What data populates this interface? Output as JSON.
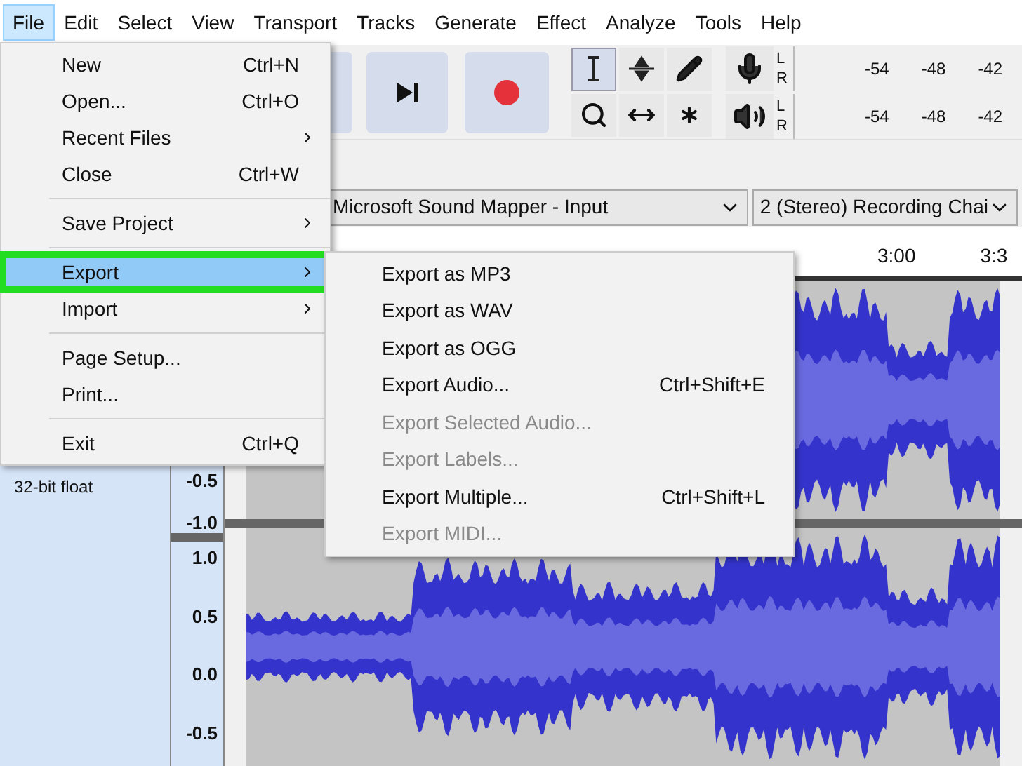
{
  "menubar": [
    {
      "label": "File",
      "selected": true
    },
    {
      "label": "Edit",
      "selected": false
    },
    {
      "label": "Select",
      "selected": false
    },
    {
      "label": "View",
      "selected": false
    },
    {
      "label": "Transport",
      "selected": false
    },
    {
      "label": "Tracks",
      "selected": false
    },
    {
      "label": "Generate",
      "selected": false
    },
    {
      "label": "Effect",
      "selected": false
    },
    {
      "label": "Analyze",
      "selected": false
    },
    {
      "label": "Tools",
      "selected": false
    },
    {
      "label": "Help",
      "selected": false
    }
  ],
  "meters": [
    {
      "kind": "record",
      "channels": [
        "L",
        "R"
      ],
      "ticks": [
        "-54",
        "-48",
        "-42"
      ]
    },
    {
      "kind": "playback",
      "channels": [
        "L",
        "R"
      ],
      "ticks": [
        "-54",
        "-48",
        "-42"
      ]
    }
  ],
  "devices": [
    {
      "value": "Microsoft Sound Mapper - Input"
    },
    {
      "value": "2 (Stereo) Recording Chai"
    }
  ],
  "ruler": {
    "labels": [
      "3:00",
      "3:3"
    ]
  },
  "track": {
    "info": [
      "32-bit float"
    ],
    "channels": [
      {
        "scale": [
          "-0.5",
          "-1.0"
        ]
      },
      {
        "scale": [
          "1.0",
          "0.5",
          "0.0",
          "-0.5"
        ]
      }
    ]
  },
  "file_menu": [
    {
      "kind": "item",
      "label": "New",
      "shortcut": "Ctrl+N",
      "submenu": false,
      "selected": false,
      "outlined": false
    },
    {
      "kind": "item",
      "label": "Open...",
      "shortcut": "Ctrl+O",
      "submenu": false,
      "selected": false,
      "outlined": false
    },
    {
      "kind": "item",
      "label": "Recent Files",
      "submenu": true,
      "selected": false,
      "outlined": false
    },
    {
      "kind": "item",
      "label": "Close",
      "shortcut": "Ctrl+W",
      "submenu": false,
      "selected": false,
      "outlined": false
    },
    {
      "kind": "separator"
    },
    {
      "kind": "item",
      "label": "Save Project",
      "submenu": true,
      "selected": false,
      "outlined": false
    },
    {
      "kind": "separator"
    },
    {
      "kind": "item",
      "label": "Export",
      "submenu": true,
      "selected": true,
      "outlined": true
    },
    {
      "kind": "item",
      "label": "Import",
      "submenu": true,
      "selected": false,
      "outlined": false
    },
    {
      "kind": "separator"
    },
    {
      "kind": "item",
      "label": "Page Setup...",
      "submenu": false,
      "selected": false,
      "outlined": false
    },
    {
      "kind": "item",
      "label": "Print...",
      "submenu": false,
      "selected": false,
      "outlined": false
    },
    {
      "kind": "separator"
    },
    {
      "kind": "item",
      "label": "Exit",
      "shortcut": "Ctrl+Q",
      "submenu": false,
      "selected": false,
      "outlined": false
    }
  ],
  "export_submenu": [
    {
      "label": "Export as MP3",
      "disabled": false
    },
    {
      "label": "Export as WAV",
      "disabled": false
    },
    {
      "label": "Export as OGG",
      "disabled": false
    },
    {
      "label": "Export Audio...",
      "shortcut": "Ctrl+Shift+E",
      "disabled": false
    },
    {
      "label": "Export Selected Audio...",
      "disabled": true
    },
    {
      "label": "Export Labels...",
      "disabled": true
    },
    {
      "label": "Export Multiple...",
      "shortcut": "Ctrl+Shift+L",
      "disabled": false
    },
    {
      "label": "Export MIDI...",
      "disabled": true
    }
  ]
}
